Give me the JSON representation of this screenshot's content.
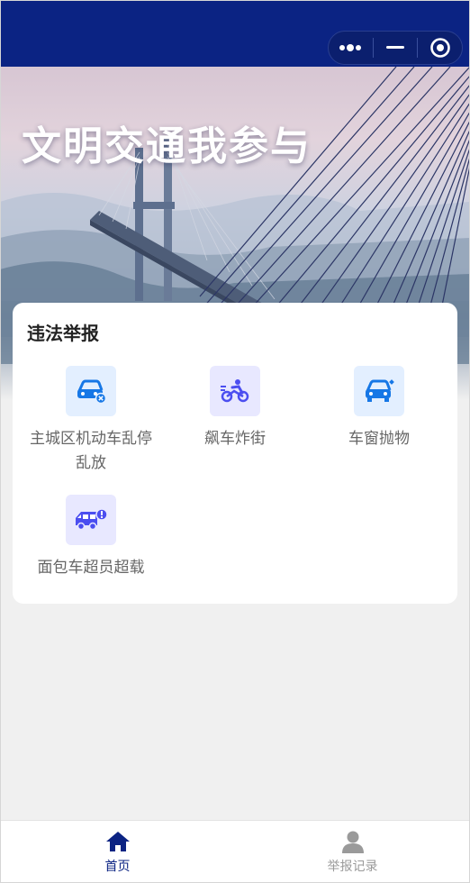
{
  "hero": {
    "title": "文明交通我参与"
  },
  "report_section": {
    "title": "违法举报",
    "items": [
      {
        "label": "主城区机动车乱停乱放",
        "icon": "car-x-icon"
      },
      {
        "label": "飙车炸街",
        "icon": "motorbike-icon"
      },
      {
        "label": "车窗抛物",
        "icon": "car-window-icon"
      },
      {
        "label": "面包车超员超载",
        "icon": "van-alert-icon"
      }
    ]
  },
  "tabbar": {
    "tabs": [
      {
        "label": "首页",
        "icon": "home-icon",
        "active": true
      },
      {
        "label": "举报记录",
        "icon": "user-icon",
        "active": false
      }
    ]
  },
  "colors": {
    "nav": "#0b2383",
    "accent": "#1677e6",
    "active_tab": "#0b2383",
    "inactive_tab": "#9a9a9a"
  }
}
